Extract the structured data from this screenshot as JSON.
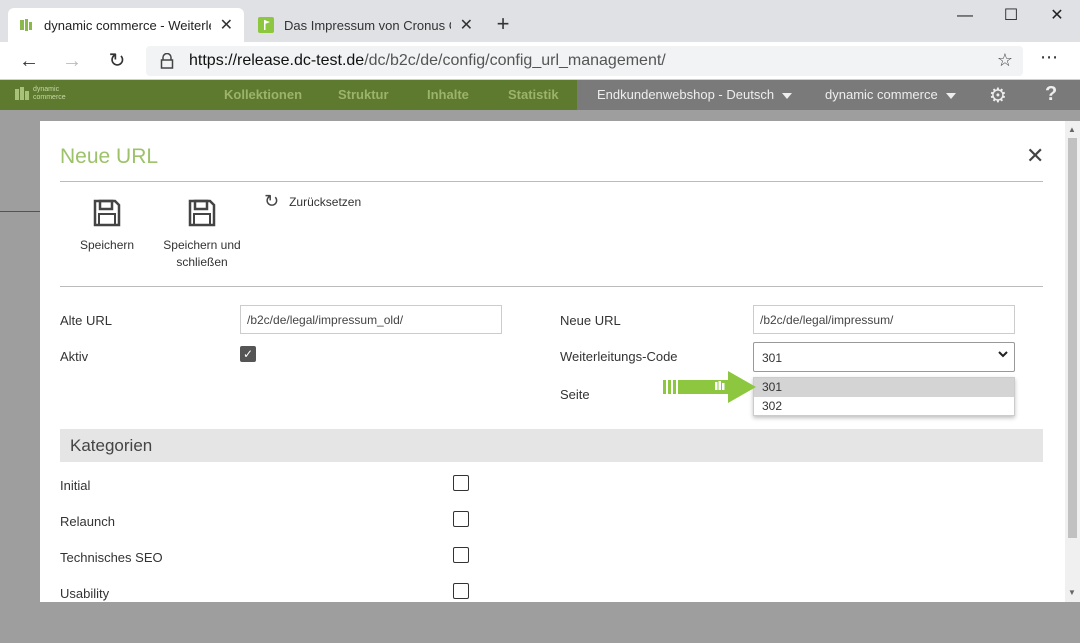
{
  "browser": {
    "tabs": [
      {
        "title": "dynamic commerce - Weiterleitu",
        "active": true
      },
      {
        "title": "Das Impressum von Cronus Golf",
        "active": false
      }
    ],
    "url_host": "https://release.dc-test.de",
    "url_path": "/dc/b2c/de/config/config_url_management/"
  },
  "appnav": {
    "logo_line1": "dynamic",
    "logo_line2": "commerce",
    "items": [
      "Kollektionen",
      "Struktur",
      "Inhalte",
      "Statistik"
    ],
    "shop_select": "Endkundenwebshop - Deutsch",
    "company_select": "dynamic commerce"
  },
  "modal": {
    "title": "Neue URL",
    "toolbar": {
      "save": "Speichern",
      "save_close_line1": "Speichern und",
      "save_close_line2": "schließen",
      "reset": "Zurücksetzen"
    },
    "form": {
      "old_url_label": "Alte URL",
      "old_url_value": "/b2c/de/legal/impressum_old/",
      "active_label": "Aktiv",
      "new_url_label": "Neue URL",
      "new_url_value": "/b2c/de/legal/impressum/",
      "redirect_label": "Weiterleitungs-Code",
      "redirect_value": "301",
      "redirect_options": [
        "301",
        "302"
      ],
      "page_label": "Seite"
    },
    "categories": {
      "heading": "Kategorien",
      "items": [
        "Initial",
        "Relaunch",
        "Technisches SEO",
        "Usability"
      ]
    }
  },
  "colors": {
    "accent_green": "#9dc26a",
    "nav_green": "#5e7a2e",
    "arrow_green": "#8dc63f"
  }
}
